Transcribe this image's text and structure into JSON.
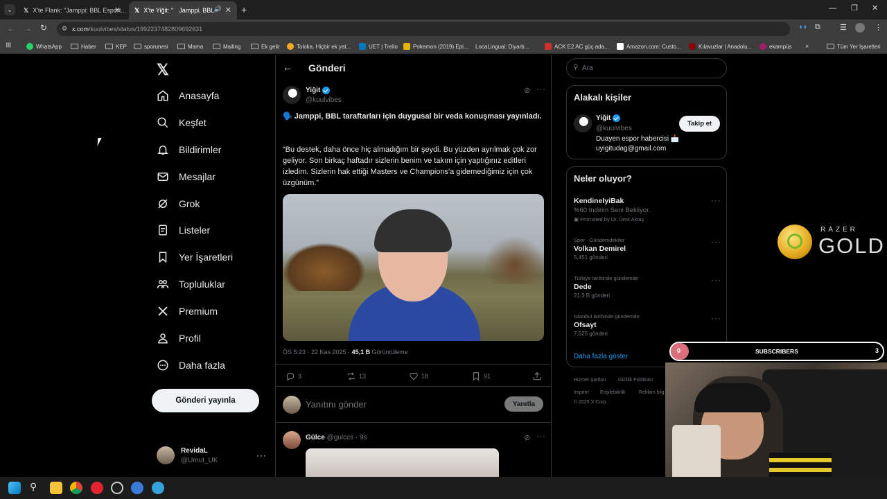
{
  "browser": {
    "tabs": [
      {
        "label": "X'te Flank: \"Jamppi; BBL Esport..."
      },
      {
        "label": "X'te Yiğit: \"",
        "label_end": "Jamppi, BBL"
      }
    ],
    "url_domain": "x.com",
    "url_path": "/kuulvibes/status/1992237482809692631",
    "bookmarks": [
      "WhatsApp",
      "Haber",
      "KEP",
      "sporunesi",
      "Mama",
      "Mailing",
      "Ek gelir",
      "Toloka. Hiçbir ek yat...",
      "UET | Trello",
      "Pokemon (2019) Epi...",
      "LocaLingual: Diyarb...",
      "ACK E2 AC güç ada...",
      "Amazon.com: Custo...",
      "Kılavuzlar | Anadolu...",
      "ekampüs",
      "Tüm Yer İşaretleri"
    ]
  },
  "sidebar": {
    "items": [
      {
        "label": "Anasayfa",
        "icon": "home-icon"
      },
      {
        "label": "Keşfet",
        "icon": "search-icon"
      },
      {
        "label": "Bildirimler",
        "icon": "bell-icon"
      },
      {
        "label": "Mesajlar",
        "icon": "mail-icon"
      },
      {
        "label": "Grok",
        "icon": "grok-icon"
      },
      {
        "label": "Listeler",
        "icon": "list-icon"
      },
      {
        "label": "Yer İşaretleri",
        "icon": "bookmark-icon"
      },
      {
        "label": "Topluluklar",
        "icon": "communities-icon"
      },
      {
        "label": "Premium",
        "icon": "x-logo-icon"
      },
      {
        "label": "Profil",
        "icon": "profile-icon"
      },
      {
        "label": "Daha fazla",
        "icon": "more-icon"
      }
    ],
    "post_button": "Gönderi yayınla",
    "account": {
      "name": "RevidaL",
      "handle": "@Umut_UK"
    }
  },
  "post": {
    "header": "Gönderi",
    "author": {
      "name": "Yiğit",
      "handle": "@kuulvibes"
    },
    "headline": "🗣️ Jamppi, BBL taraftarları için duygusal bir veda konuşması yayınladı.",
    "quote": "“Bu destek, daha önce hiç almadığım bir şeydi. Bu yüzden ayrılmak çok zor geliyor. Son birkaç haftadır sizlerin benim ve takım için yaptığınız editleri izledim. Sizlerin hak ettiği Masters ve Champions'a gidemediğimiz için çok üzgünüm.”",
    "time": "ÖS 5:23 · 22 Kas 2025 · ",
    "views": "45,1 B",
    "views_label": " Görüntüleme",
    "replies": "3",
    "reposts": "13",
    "likes": "18",
    "bookmarks": "91",
    "reply_placeholder": "Yanıtını gönder",
    "reply_button": "Yanıtla"
  },
  "reply": {
    "name": "Gülce",
    "handle": "@gulccs · 9s"
  },
  "right": {
    "search_placeholder": "Ara",
    "related_title": "Alakalı kişiler",
    "related": {
      "name": "Yiğit",
      "handle": "@kuulvibes",
      "follow": "Takip et",
      "bio": "Duayen espor habercisi 📩",
      "email": "uyigitudag@gmail.com"
    },
    "whats_title": "Neler oluyor?",
    "trends": [
      {
        "meta": "",
        "name": "KendineIyiBak",
        "sub": "%60 İndirim Seni Bekliyor.",
        "extra": "Promoted by Dr. Ümit Aktaş"
      },
      {
        "meta": "Spor · Gündemdekiler",
        "name": "Volkan Demirel",
        "sub": "5.451 gönderi"
      },
      {
        "meta": "Türkiye tarihinde gündemde",
        "name": "Dede",
        "sub": "21,3 B gönderi"
      },
      {
        "meta": "İstanbul tarihinde gündemde",
        "name": "Ofsayt",
        "sub": "7.525 gönderi"
      }
    ],
    "show_more": "Daha fazla göster",
    "footer": [
      "Hizmet Şartları",
      "Gizlilik Politikası",
      "Imprint",
      "Erişilebilirlik",
      "Reklam bilg",
      "© 2025 X Corp."
    ]
  },
  "overlay": {
    "sub_left": "0",
    "sub_label": "SUBSCRIBERS",
    "sub_right": "3",
    "razer": "RAZER",
    "gold": "GOLD"
  },
  "colors": {
    "accent": "#1d9bf0",
    "bg": "#000000",
    "border": "#2f3336"
  }
}
